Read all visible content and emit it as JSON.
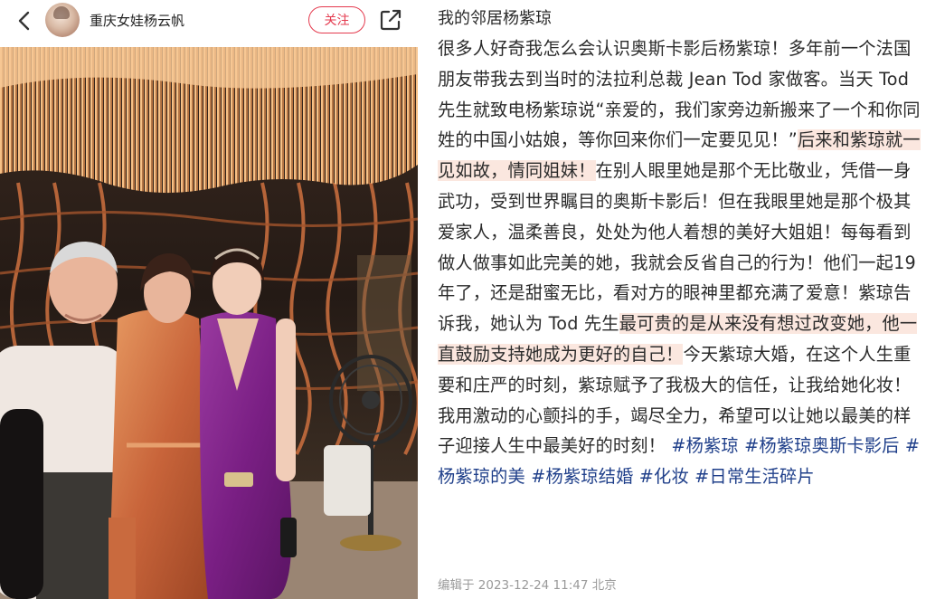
{
  "header": {
    "user_name": "重庆女娃杨云帆",
    "follow_label": "关注",
    "icons": {
      "back": "chevron-left-icon",
      "share": "share-icon"
    }
  },
  "post": {
    "title": "我的邻居杨紫琼",
    "body": [
      {
        "text": "很多人好奇我怎么会认识奥斯卡影后杨紫琼！多年前一个法国朋友带我去到当时的法拉利总裁 Jean Tod 家做客。当天 Tod 先生就致电杨紫琼说“亲爱的，我们家旁边新搬来了一个和你同姓的中国小姑娘，等你回来你们一定要见见！”",
        "highlight": false
      },
      {
        "text": "后来和紫琼就一见如故，情同姐妹！",
        "highlight": true
      },
      {
        "text": "在别人眼里她是那个无比敬业，凭借一身武功，受到世界瞩目的奥斯卡影后！但在我眼里她是那个极其爱家人，温柔善良，处处为他人着想的美好大姐姐！每每看到做人做事如此完美的她，我就会反省自己的行为！他们一起19年了，还是甜蜜无比，看对方的眼神里都充满了爱意！紫琼告诉我，她认为 Tod 先生",
        "highlight": false
      },
      {
        "text": "最可贵的是从来没有想过改变她，他一直鼓励支持她成为更好的自己！",
        "highlight": true
      },
      {
        "text": "今天紫琼大婚，在这个人生重要和庄严的时刻，紫琼赋予了我极大的信任，让我给她化妆！我用激动的心颤抖的手，竭尽全力，希望可以让她以最美的样子迎接人生中最美好的时刻！",
        "highlight": false
      }
    ],
    "hashtags": [
      "#杨紫琼",
      "#杨紫琼奥斯卡影后",
      "#杨紫琼的美",
      "#杨紫琼结婚",
      "#化妆",
      "#日常生活碎片"
    ],
    "edit_info": "编辑于 2023-12-24 11:47 北京"
  },
  "colors": {
    "accent": "#e43a4e",
    "hashtag": "#1f3f8a",
    "highlight": "#fbe7df"
  }
}
